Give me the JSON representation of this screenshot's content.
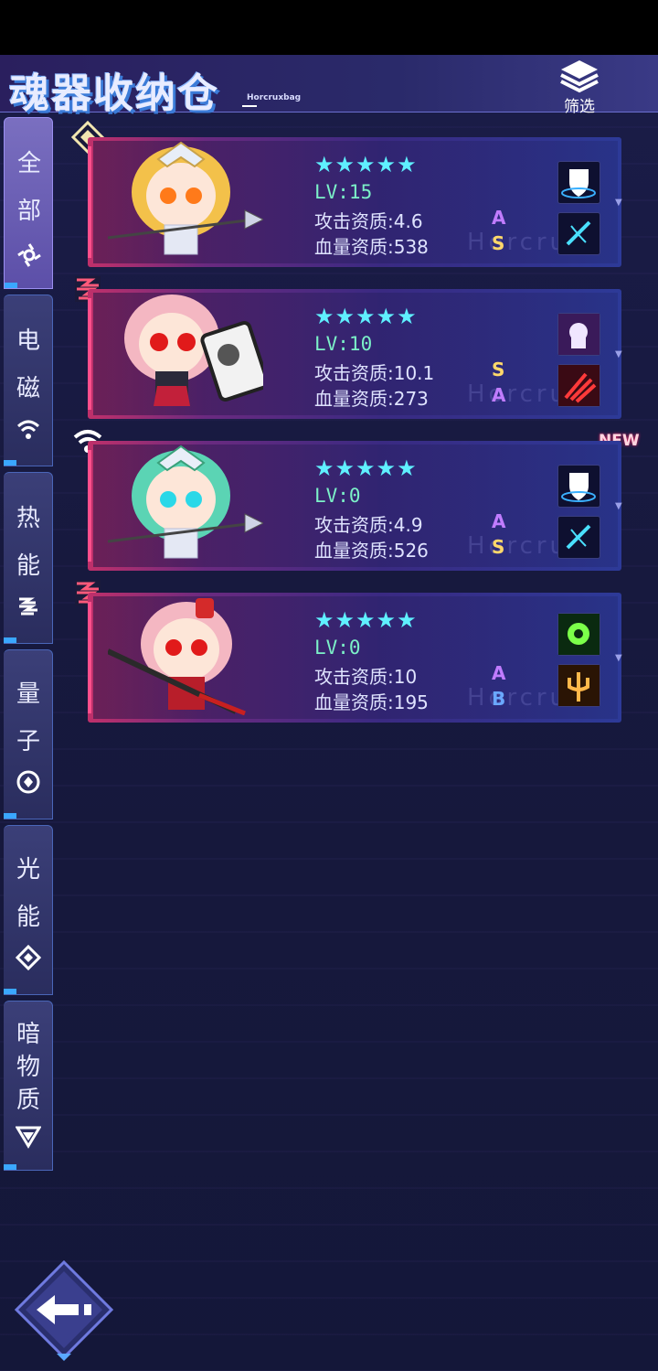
{
  "header": {
    "title": "魂器收纳仓",
    "subtitle": "Horcruxbag",
    "filter_label": "筛选"
  },
  "tabs": [
    {
      "label": "全\n部",
      "icon": "swirl-icon",
      "active": true
    },
    {
      "label": "电\n磁",
      "icon": "wifi-icon",
      "active": false
    },
    {
      "label": "热\n能",
      "icon": "heat-wave-icon",
      "active": false
    },
    {
      "label": "量\n子",
      "icon": "quantum-icon",
      "active": false
    },
    {
      "label": "光\n能",
      "icon": "diamond-icon",
      "active": false
    },
    {
      "label": "暗\n物\n质",
      "icon": "dark-matter-icon",
      "active": false
    }
  ],
  "cards": [
    {
      "element_icon": "light-diamond-icon",
      "stars": "★★★★★",
      "level": "LV:15",
      "attack": "攻击资质:4.6",
      "attack_grade": "A",
      "hp": "血量资质:538",
      "hp_grade": "S",
      "attack_grade_color": "#c07cff",
      "hp_grade_color": "#ffd86a",
      "new": false
    },
    {
      "element_icon": "heat-icon",
      "stars": "★★★★★",
      "level": "LV:10",
      "attack": "攻击资质:10.1",
      "attack_grade": "S",
      "hp": "血量资质:273",
      "hp_grade": "A",
      "attack_grade_color": "#ffd86a",
      "hp_grade_color": "#c07cff",
      "new": false
    },
    {
      "element_icon": "wifi-element-icon",
      "stars": "★★★★★",
      "level": "LV:0",
      "attack": "攻击资质:4.9",
      "attack_grade": "A",
      "hp": "血量资质:526",
      "hp_grade": "S",
      "attack_grade_color": "#c07cff",
      "hp_grade_color": "#ffd86a",
      "new": true
    },
    {
      "element_icon": "heat-icon",
      "stars": "★★★★★",
      "level": "LV:0",
      "attack": "攻击资质:10",
      "attack_grade": "A",
      "hp": "血量资质:195",
      "hp_grade": "B",
      "attack_grade_color": "#c07cff",
      "hp_grade_color": "#6aa8ff",
      "new": false
    }
  ],
  "new_label": "NEW",
  "watermark": "Horcrux"
}
